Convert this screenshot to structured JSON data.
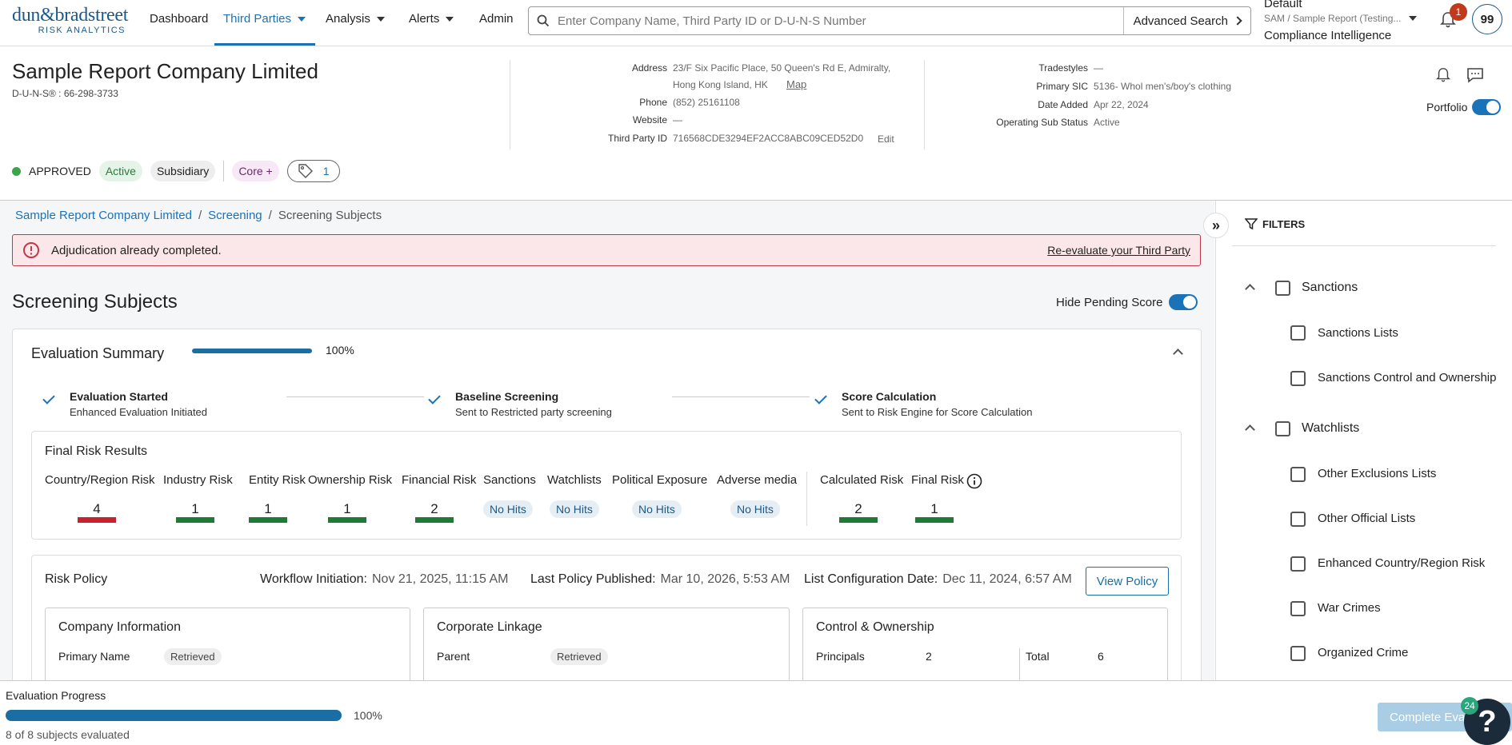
{
  "nav": {
    "logo_main": "dun&bradstreet",
    "logo_sub": "RISK ANALYTICS",
    "items": [
      "Dashboard",
      "Third Parties",
      "Analysis",
      "Alerts",
      "Admin"
    ],
    "search_placeholder": "Enter Company Name, Third Party ID or D-U-N-S Number",
    "advanced_search": "Advanced Search",
    "account_line1": "Default",
    "account_line2": "SAM / Sample Report (Testing...",
    "account_line3": "Compliance Intelligence",
    "notif_count": "1",
    "avatar": "99"
  },
  "company": {
    "name": "Sample Report Company Limited",
    "duns": "D-U-N-S® : 66-298-3733",
    "address_label": "Address",
    "address_line1": "23/F Six Pacific Place, 50 Queen's Rd E, Admiralty,",
    "address_line2": "Hong Kong Island, HK",
    "map_link": "Map",
    "phone_label": "Phone",
    "phone": "(852) 25161108",
    "website_label": "Website",
    "website": "—",
    "tpid_label": "Third Party ID",
    "tpid": "716568CDE3294EF2ACC8ABC09CED52D0",
    "edit_link": "Edit",
    "tradestyles_label": "Tradestyles",
    "tradestyles": "—",
    "sic_label": "Primary SIC",
    "sic": "5136- Whol men's/boy's clothing",
    "date_added_label": "Date Added",
    "date_added": "Apr 22, 2024",
    "sub_status_label": "Operating Sub Status",
    "sub_status": "Active",
    "portfolio_label": "Portfolio",
    "approved": "APPROVED",
    "pill_active": "Active",
    "pill_subsidiary": "Subsidiary",
    "pill_core": "Core +",
    "tag_count": "1"
  },
  "breadcrumb": [
    "Sample Report Company Limited",
    "/",
    "Screening",
    "/",
    "Screening Subjects"
  ],
  "alert": {
    "message": "Adjudication already completed.",
    "link": "Re-evaluate your Third Party"
  },
  "page_title": "Screening Subjects",
  "hide_pending": "Hide Pending Score",
  "evaluation": {
    "title": "Evaluation Summary",
    "progress_pct": 100,
    "progress_label": "100%",
    "steps": [
      {
        "title": "Evaluation Started",
        "sub": "Enhanced Evaluation Initiated"
      },
      {
        "title": "Baseline Screening",
        "sub": "Sent to Restricted party screening"
      },
      {
        "title": "Score Calculation",
        "sub": "Sent to Risk Engine for Score Calculation"
      }
    ]
  },
  "final_risk": {
    "title": "Final Risk Results",
    "items": [
      {
        "label": "Country/Region Risk",
        "value": "4",
        "color": "#c8222e"
      },
      {
        "label": "Industry Risk",
        "value": "1",
        "color": "#1f7a36"
      },
      {
        "label": "Entity Risk",
        "value": "1",
        "color": "#1f7a36"
      },
      {
        "label": "Ownership Risk",
        "value": "1",
        "color": "#1f7a36"
      },
      {
        "label": "Financial Risk",
        "value": "2",
        "color": "#1f7a36"
      },
      {
        "label": "Sanctions",
        "value": "No Hits"
      },
      {
        "label": "Watchlists",
        "value": "No Hits"
      },
      {
        "label": "Political Exposure",
        "value": "No Hits"
      },
      {
        "label": "Adverse media",
        "value": "No Hits"
      },
      {
        "label": "Calculated Risk",
        "value": "2",
        "color": "#1f7a36"
      },
      {
        "label": "Final Risk",
        "value": "1",
        "color": "#1f7a36"
      }
    ]
  },
  "policy": {
    "title": "Risk Policy",
    "workflow_label": "Workflow Initiation:",
    "workflow_value": "Nov 21, 2025, 11:15 AM",
    "published_label": "Last Policy Published:",
    "published_value": "Mar 10, 2026, 5:53 AM",
    "config_label": "List Configuration Date:",
    "config_value": "Dec 11, 2024, 6:57 AM",
    "view_button": "View Policy",
    "company_info": {
      "title": "Company Information",
      "key": "Primary Name",
      "status": "Retrieved"
    },
    "linkage": {
      "title": "Corporate Linkage",
      "key": "Parent",
      "status": "Retrieved"
    },
    "control": {
      "title": "Control & Ownership",
      "key1": "Principals",
      "val1": "2",
      "key2": "Total",
      "val2": "6"
    }
  },
  "filters": {
    "title": "FILTERS",
    "groups": [
      {
        "label": "Sanctions",
        "items": [
          "Sanctions Lists",
          "Sanctions Control and Ownership"
        ]
      },
      {
        "label": "Watchlists",
        "items": [
          "Other Exclusions Lists",
          "Other Official Lists",
          "Enhanced Country/Region Risk",
          "War Crimes",
          "Organized Crime"
        ]
      }
    ]
  },
  "bottom": {
    "title": "Evaluation Progress",
    "progress_pct": 100,
    "progress_label": "100%",
    "sub": "8 of 8 subjects evaluated",
    "complete_button": "Complete Evaluation",
    "help_badge": "24"
  },
  "colors": {
    "accent": "#1a73b8",
    "brand": "#1a5a8a",
    "danger": "#c8222e",
    "success": "#1f7a36"
  }
}
